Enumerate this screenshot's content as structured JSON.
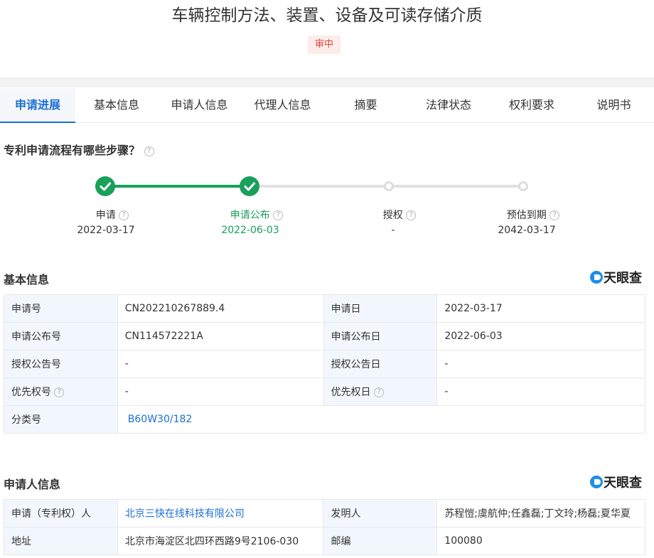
{
  "title": "车辆控制方法、装置、设备及可读存储介质",
  "status_badge": "审中",
  "tabs": [
    "申请进展",
    "基本信息",
    "申请人信息",
    "代理人信息",
    "摘要",
    "法律状态",
    "权利要求",
    "说明书"
  ],
  "progress": {
    "title": "专利申请流程有哪些步骤？",
    "steps": [
      {
        "label": "申请",
        "date": "2022-03-17",
        "state": "done"
      },
      {
        "label": "申请公布",
        "date": "2022-06-03",
        "state": "done"
      },
      {
        "label": "授权",
        "date": "-",
        "state": "todo"
      },
      {
        "label": "预估到期",
        "date": "2042-03-17",
        "state": "todo"
      }
    ]
  },
  "colors": {
    "accent": "#1c6fd6",
    "done": "#19a05a",
    "badge_text": "#e0453a"
  },
  "logo": "天眼查",
  "basic_info": {
    "title": "基本信息",
    "app_no_label": "申请号",
    "app_no": "CN202210267889.4",
    "app_date_label": "申请日",
    "app_date": "2022-03-17",
    "pub_no_label": "申请公布号",
    "pub_no": "CN114572221A",
    "pub_date_label": "申请公布日",
    "pub_date": "2022-06-03",
    "grant_no_label": "授权公告号",
    "grant_no": "-",
    "grant_date_label": "授权公告日",
    "grant_date": "-",
    "priority_no_label": "优先权号",
    "priority_no": "-",
    "priority_date_label": "优先权日",
    "priority_date": "-",
    "class_label": "分类号",
    "class_no": "B60W30/182"
  },
  "applicant_info": {
    "title": "申请人信息",
    "applicant_label": "申请（专利权）人",
    "applicant": "北京三快在线科技有限公司",
    "inventor_label": "发明人",
    "inventors": "苏程愷;虞航仲;任鑫磊;丁文玲;杨磊;夏华夏",
    "address_label": "地址",
    "address": "北京市海淀区北四环西路9号2106-030",
    "zip_label": "邮编",
    "zip": "100080"
  }
}
